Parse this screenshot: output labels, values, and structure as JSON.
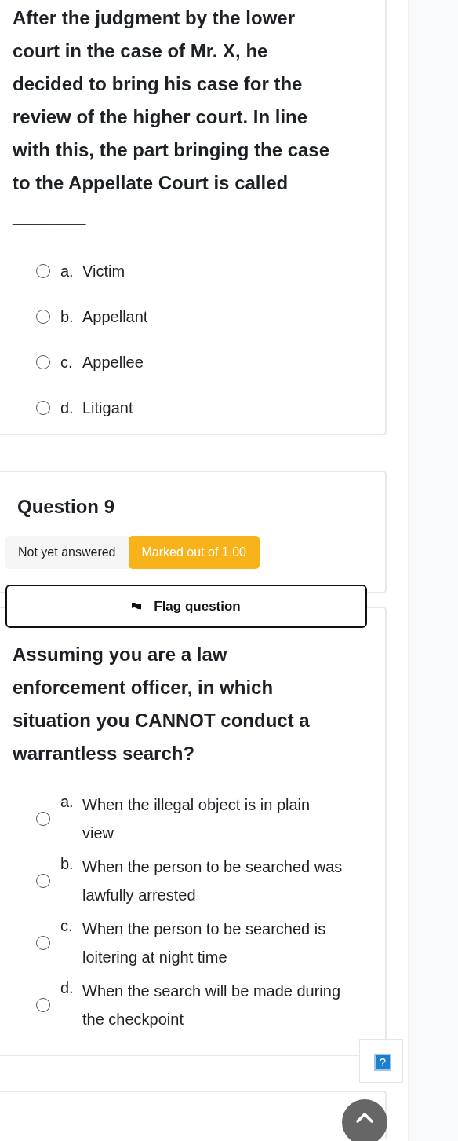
{
  "previous_question": {
    "text": "After the judgment by the lower court in the case of Mr. X, he decided to bring his case for the review of the higher court. In line with this, the part bringing the case to the Appellate Court is called _______",
    "options": [
      {
        "letter": "a.",
        "text": "Victim",
        "selected": false
      },
      {
        "letter": "b.",
        "text": "Appellant",
        "selected": false
      },
      {
        "letter": "c.",
        "text": "Appellee",
        "selected": false
      },
      {
        "letter": "d.",
        "text": "Litigant",
        "selected": false
      }
    ]
  },
  "question": {
    "title": "Question 9",
    "status": "Not yet answered",
    "marks": "Marked out of 1.00",
    "flag_button": {
      "label": "Flag question",
      "flagged": false
    },
    "text": "Assuming you are a law enforcement officer, in which situation you CANNOT conduct a warrantless search?",
    "options": [
      {
        "letter": "a.",
        "text": "When the illegal object is in plain view",
        "selected": false
      },
      {
        "letter": "b.",
        "text": "When the person to be searched was lawfully arrested",
        "selected": false
      },
      {
        "letter": "c.",
        "text": "When the person to be searched is loitering at night time",
        "selected": false
      },
      {
        "letter": "d.",
        "text": "When the search will be made during the checkpoint",
        "selected": false
      }
    ]
  },
  "help_button": {
    "label": "?"
  }
}
